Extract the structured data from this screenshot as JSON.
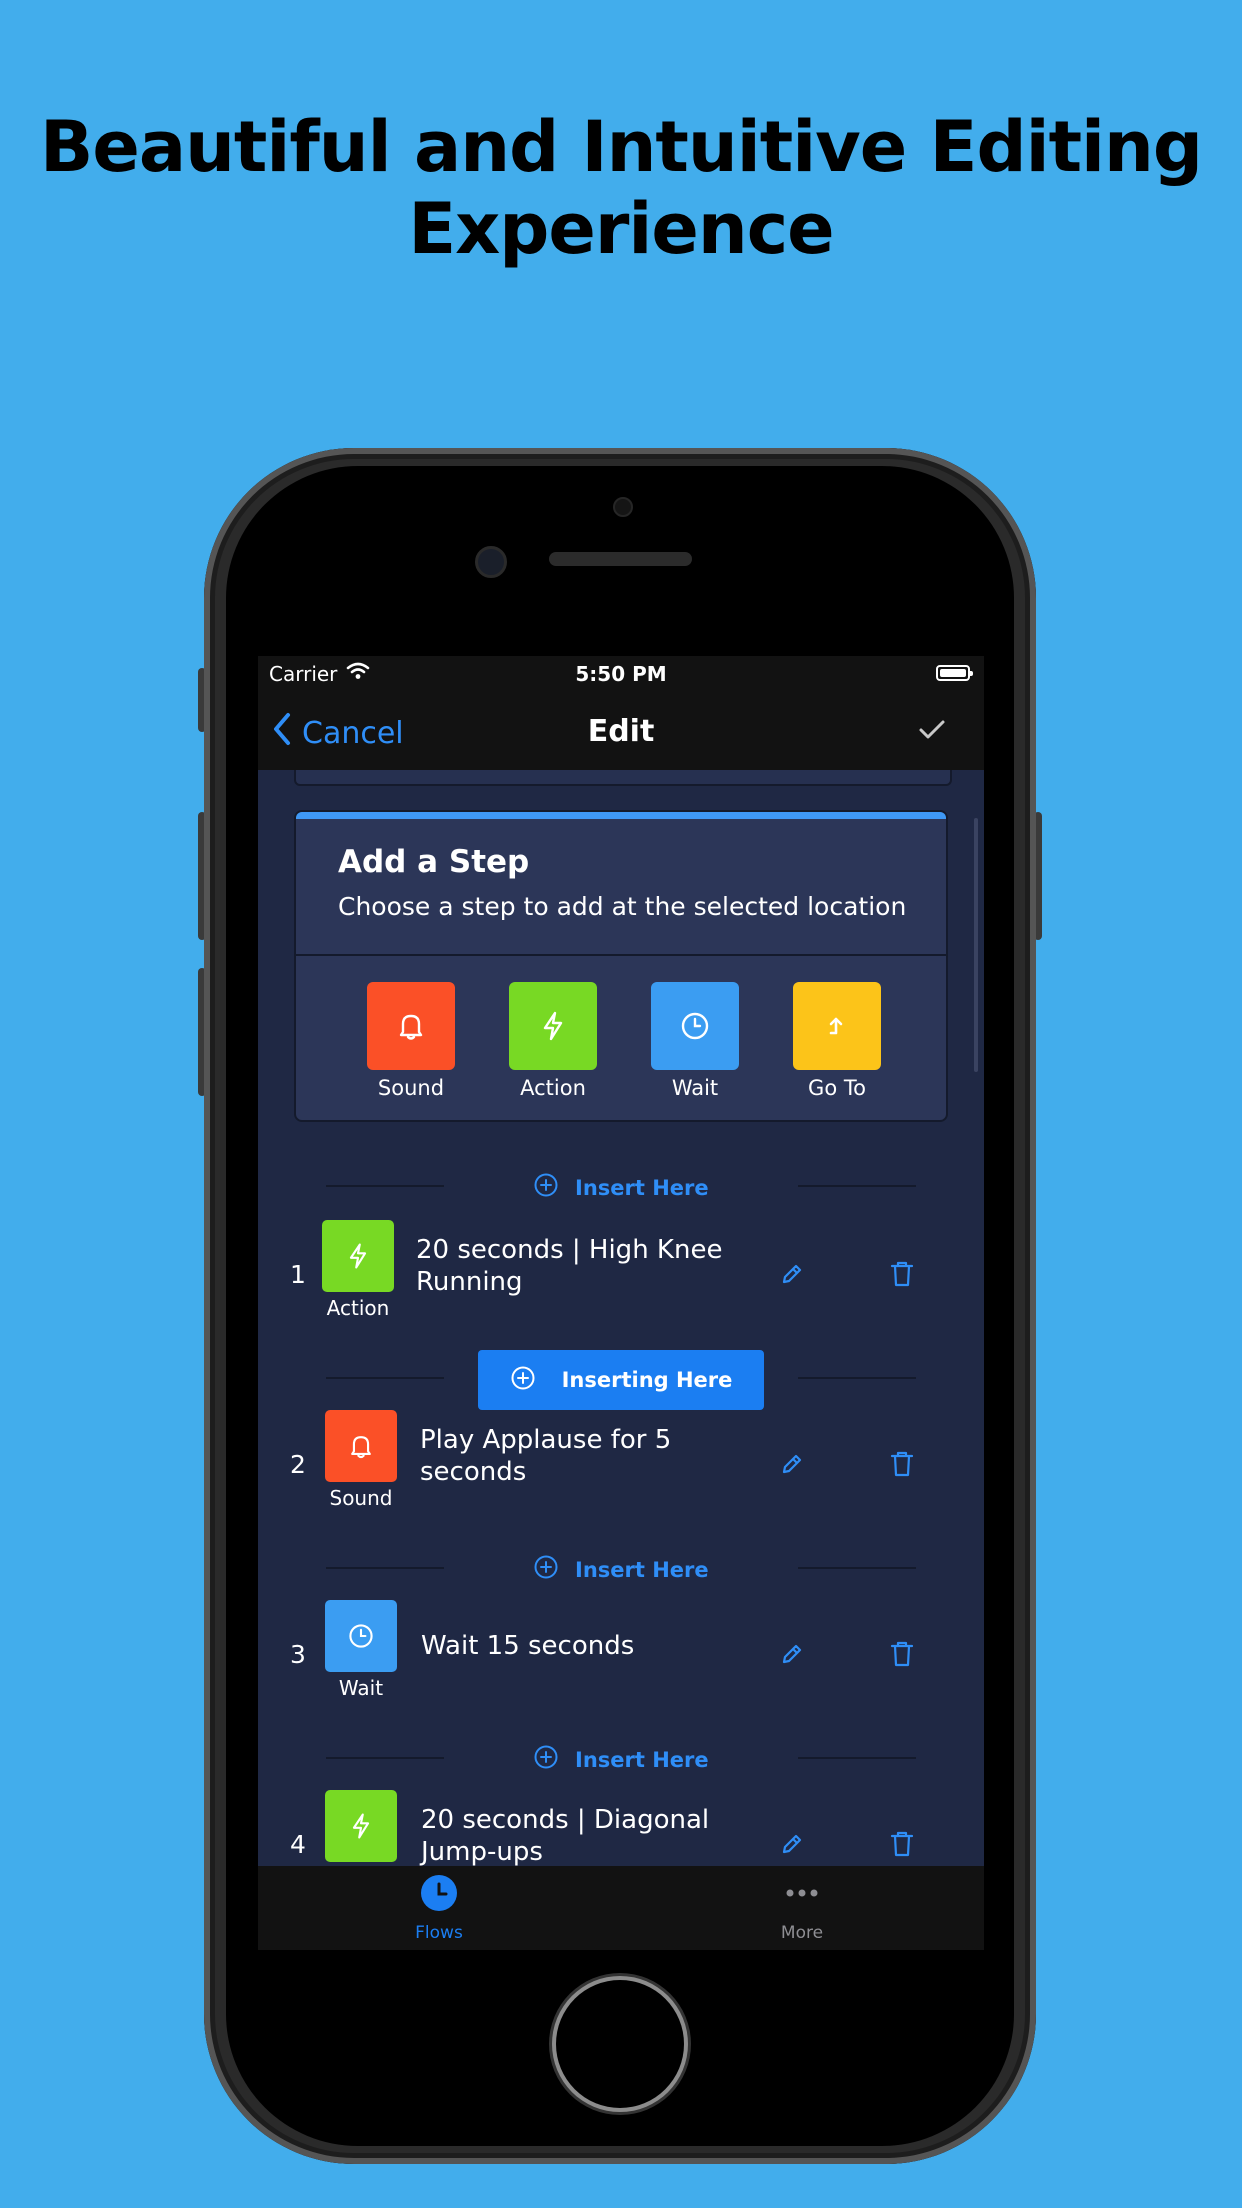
{
  "headline": {
    "line1": "Beautiful and Intuitive Editing",
    "line2": "Experience"
  },
  "status_bar": {
    "carrier": "Carrier",
    "time": "5:50 PM"
  },
  "nav": {
    "back_label": "Cancel",
    "title": "Edit"
  },
  "add_step": {
    "title": "Add a Step",
    "subtitle": "Choose a step to add at the selected location",
    "options": [
      {
        "label": "Sound",
        "icon": "bell-icon",
        "color": "#fb5027"
      },
      {
        "label": "Action",
        "icon": "bolt-icon",
        "color": "#78d924"
      },
      {
        "label": "Wait",
        "icon": "clock-icon",
        "color": "#3b9df2"
      },
      {
        "label": "Go To",
        "icon": "goto-arrow-icon",
        "color": "#fcc419"
      }
    ]
  },
  "insert_here_label": "Insert Here",
  "inserting_here_label": "Inserting Here",
  "steps": [
    {
      "number": "1",
      "type": "Action",
      "icon": "bolt-icon",
      "color": "#78d924",
      "text": "20 seconds | High Knee Running"
    },
    {
      "number": "2",
      "type": "Sound",
      "icon": "bell-icon",
      "color": "#fb5027",
      "text": "Play Applause for 5 seconds"
    },
    {
      "number": "3",
      "type": "Wait",
      "icon": "clock-icon",
      "color": "#3b9df2",
      "text": "Wait 15 seconds"
    },
    {
      "number": "4",
      "type": "Action",
      "icon": "bolt-icon",
      "color": "#78d924",
      "text": "20 seconds | Diagonal Jump-ups"
    }
  ],
  "tab_bar": {
    "tabs": [
      {
        "label": "Flows",
        "icon": "clock-icon",
        "active": true
      },
      {
        "label": "More",
        "icon": "ellipsis-icon",
        "active": false
      }
    ]
  },
  "colors": {
    "background": "#42adec",
    "accent": "#2f8ef7",
    "screen_bg": "#1f2844",
    "card_bg": "#2c3658"
  }
}
